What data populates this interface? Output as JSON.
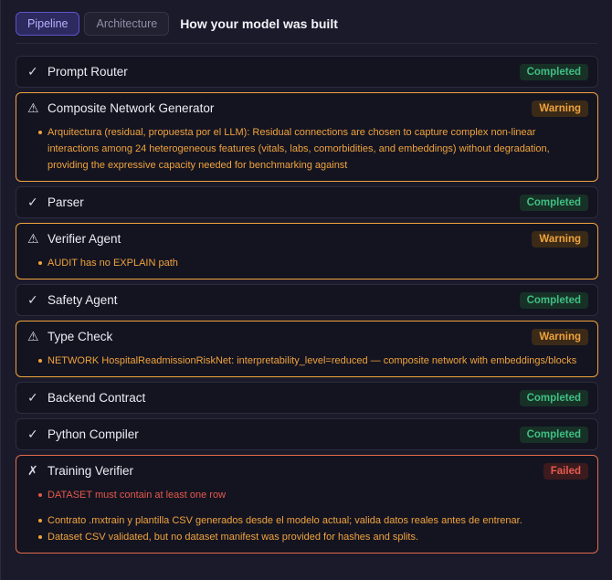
{
  "tabs": [
    {
      "label": "Pipeline",
      "active": true
    },
    {
      "label": "Architecture",
      "active": false
    }
  ],
  "page_title": "How your model was built",
  "icons": {
    "check": "check-icon",
    "warning": "warning-icon",
    "fail": "x-icon"
  },
  "colors": {
    "completed": "#3fbf83",
    "warning": "#f0a33c",
    "failed": "#e65a4f",
    "accent": "#5b55c9"
  },
  "steps": [
    {
      "name": "Prompt Router",
      "status": "Completed",
      "icon": "✓"
    },
    {
      "name": "Composite Network Generator",
      "status": "Warning",
      "icon": "⚠",
      "messages": [
        "Arquitectura (residual, propuesta por el LLM): Residual connections are chosen to capture complex non-linear interactions among 24 heterogeneous features (vitals, labs, comorbidities, and embeddings) without degradation, providing the expressive capacity needed for benchmarking against"
      ]
    },
    {
      "name": "Parser",
      "status": "Completed",
      "icon": "✓"
    },
    {
      "name": "Verifier Agent",
      "status": "Warning",
      "icon": "⚠",
      "messages": [
        "AUDIT has no EXPLAIN path"
      ]
    },
    {
      "name": "Safety Agent",
      "status": "Completed",
      "icon": "✓"
    },
    {
      "name": "Type Check",
      "status": "Warning",
      "icon": "⚠",
      "messages": [
        "NETWORK HospitalReadmissionRiskNet: interpretability_level=reduced — composite network with embeddings/blocks"
      ]
    },
    {
      "name": "Backend Contract",
      "status": "Completed",
      "icon": "✓"
    },
    {
      "name": "Python Compiler",
      "status": "Completed",
      "icon": "✓"
    },
    {
      "name": "Training Verifier",
      "status": "Failed",
      "icon": "✗",
      "errors": [
        "DATASET must contain at least one row"
      ],
      "messages": [
        "Contrato .mxtrain y plantilla CSV generados desde el modelo actual; valida datos reales antes de entrenar.",
        "Dataset CSV validated, but no dataset manifest was provided for hashes and splits."
      ]
    }
  ]
}
